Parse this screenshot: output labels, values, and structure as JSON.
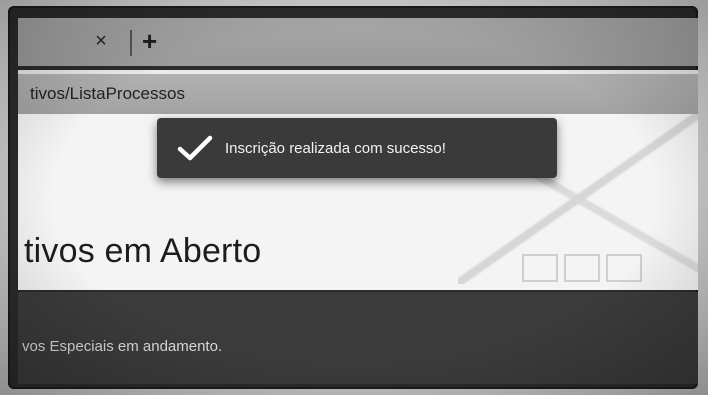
{
  "browser": {
    "tab_close_glyph": "×",
    "new_tab_glyph": "+",
    "url": "tivos/ListaProcessos"
  },
  "notification": {
    "message": "Inscrição realizada com sucesso!",
    "icon": "checkmark-icon"
  },
  "page": {
    "title": "tivos em Aberto"
  },
  "footer": {
    "text": "vos Especiais em andamento."
  }
}
